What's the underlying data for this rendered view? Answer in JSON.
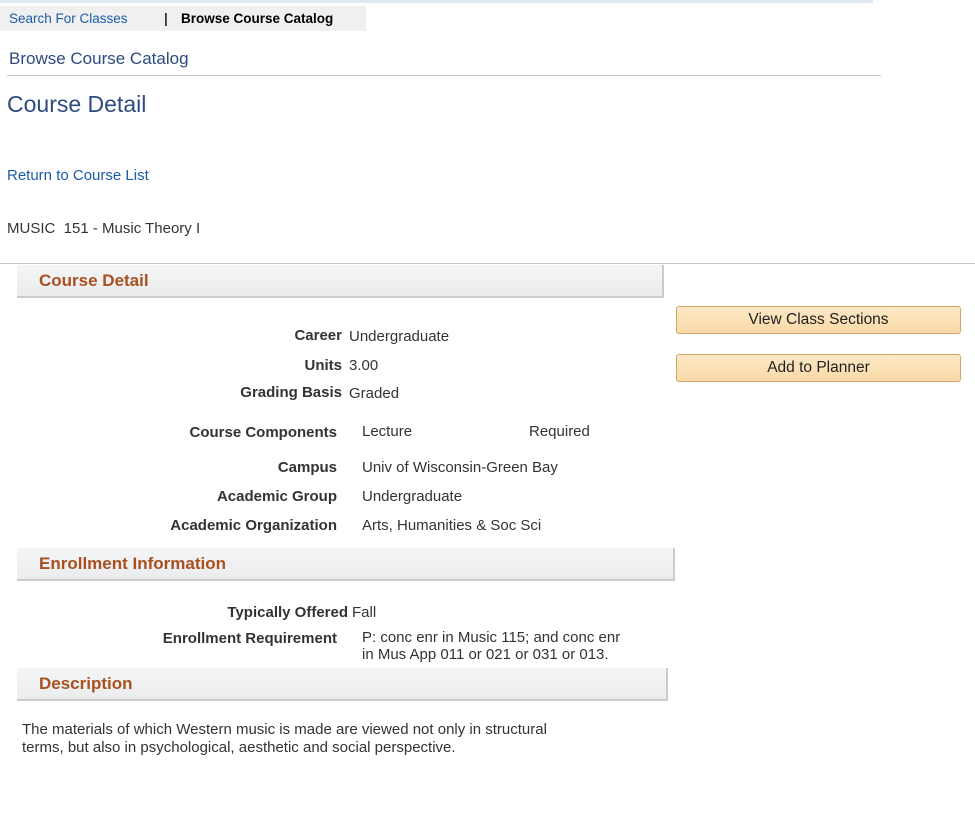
{
  "nav": {
    "search_link": "Search For Classes",
    "separator": "|",
    "current_tab": "Browse Course Catalog"
  },
  "page": {
    "subtitle": "Browse Course Catalog",
    "title": "Course Detail",
    "return_link": "Return to Course List",
    "course_name": "MUSIC  151 - Music Theory I"
  },
  "course_detail": {
    "header": "Course Detail",
    "career_label": "Career",
    "career_value": "Undergraduate",
    "units_label": "Units",
    "units_value": "3.00",
    "grading_label": "Grading Basis",
    "grading_value": "Graded",
    "components_label": "Course Components",
    "component_type": "Lecture",
    "component_status": "Required",
    "campus_label": "Campus",
    "campus_value": "Univ of Wisconsin-Green Bay",
    "group_label": "Academic Group",
    "group_value": "Undergraduate",
    "org_label": "Academic Organization",
    "org_value": "Arts, Humanities & Soc Sci"
  },
  "actions": {
    "view_sections": "View Class Sections",
    "add_planner": "Add to Planner"
  },
  "enrollment": {
    "header": "Enrollment Information",
    "offered_label": "Typically Offered",
    "offered_value": "Fall",
    "requirement_label": "Enrollment Requirement",
    "requirement_line1": "P: conc enr in Music 115; and conc enr",
    "requirement_line2": "in Mus App 011 or 021 or 031 or 013."
  },
  "description": {
    "header": "Description",
    "line1": "The materials of which Western music is made are viewed not only in structural",
    "line2": "terms, but also in psychological, aesthetic and social perspective."
  }
}
